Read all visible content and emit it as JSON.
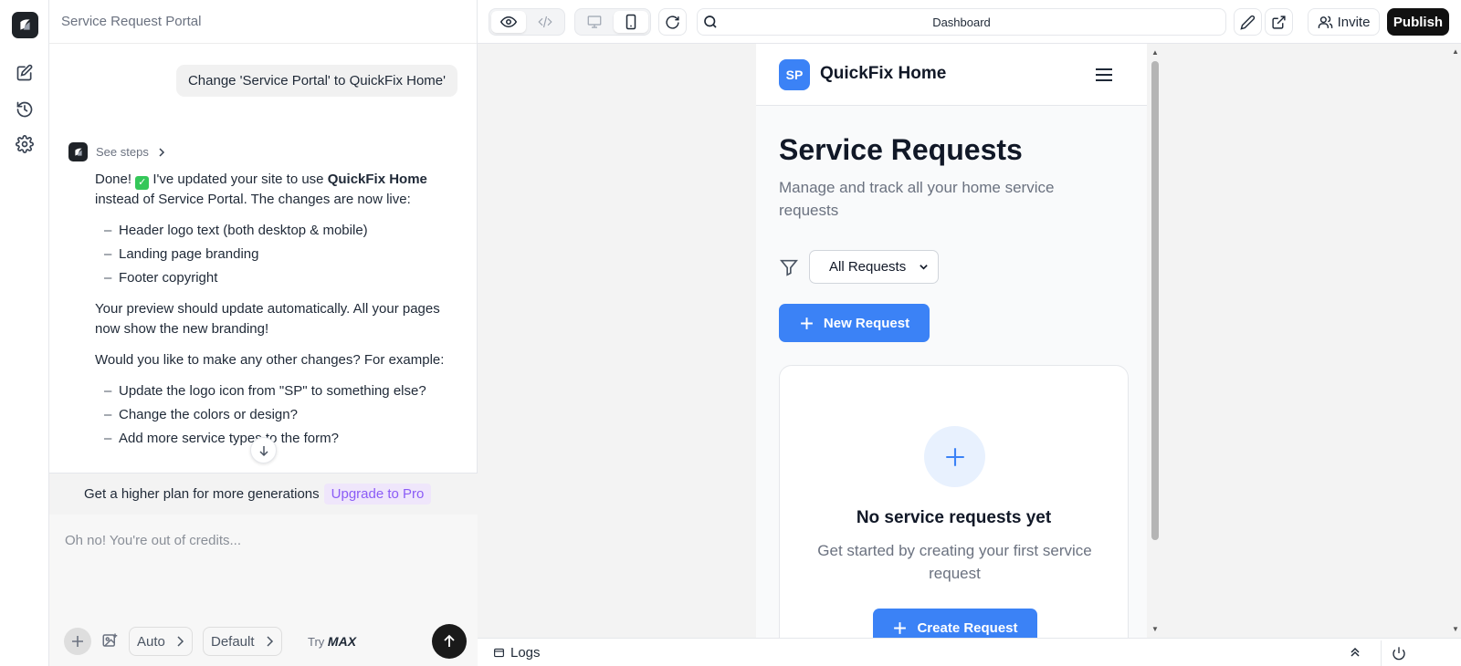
{
  "chat": {
    "title": "Service Request Portal",
    "user_message": "Change 'Service Portal' to QuickFix Home'",
    "see_steps": "See steps",
    "reply": {
      "intro_before": "Done!",
      "intro_mid": "I've updated your site to use",
      "brand": "QuickFix Home",
      "intro_after": "instead of Service Portal. The changes are now live:",
      "changes": [
        "Header logo text (both desktop & mobile)",
        "Landing page branding",
        "Footer copyright"
      ],
      "para2": "Your preview should update automatically. All your pages now show the new branding!",
      "para3": "Would you like to make any other changes? For example:",
      "suggestions": [
        "Update the logo icon from \"SP\" to something else?",
        "Change the colors or design?",
        "Add more service types to the form?"
      ]
    },
    "upgrade_text": "Get a higher plan for more generations",
    "upgrade_link": "Upgrade to Pro",
    "composer_placeholder": "Oh no! You're out of credits...",
    "mode_label": "Auto",
    "model_label": "Default",
    "try_label": "Try",
    "try_brand": "MAX"
  },
  "toolbar": {
    "url_text": "Dashboard",
    "invite_label": "Invite",
    "publish_label": "Publish"
  },
  "app": {
    "logo_initials": "SP",
    "name": "QuickFix Home",
    "page_title": "Service Requests",
    "page_subtitle": "Manage and track all your home service requests",
    "filter_value": "All Requests",
    "new_button": "New Request",
    "empty_title": "No service requests yet",
    "empty_subtitle": "Get started by creating your first service request",
    "create_button": "Create Request"
  },
  "logs": {
    "label": "Logs"
  },
  "colors": {
    "accent": "#3b82f6",
    "upgrade": "#8b5cf6",
    "publish": "#111111"
  }
}
